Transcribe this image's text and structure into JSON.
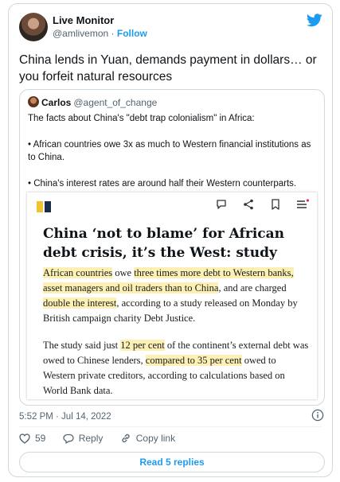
{
  "tweet": {
    "author_name": "Live Monitor",
    "author_handle": "@amlivemon",
    "separator": " · ",
    "follow_label": "Follow",
    "text": "China lends in Yuan, demands payment in dollars… or you forfeit natural resources",
    "timestamp": "5:52 PM · Jul 14, 2022",
    "likes": "59",
    "reply_label": "Reply",
    "copy_link_label": "Copy link",
    "read_replies_label": "Read 5 replies"
  },
  "quote": {
    "author_name": "Carlos",
    "author_handle": "@agent_of_change",
    "paragraphs": [
      "The facts about China's \"debt trap colonialism\" in Africa:",
      "• African countries owe 3x as much to Western financial institutions as to China.",
      "• China's interest rates are around half their Western counterparts."
    ]
  },
  "article": {
    "headline": "China ‘not to blame’ for African debt crisis, it’s the West: study",
    "p1": {
      "s1": "African countries",
      "s2": " owe ",
      "s3": "three times more debt to Western banks, asset managers and oil traders than to China",
      "s4": ", and are charged ",
      "s5": "double the interest",
      "s6": ", according to a study released on Monday by British campaign charity Debt Justice."
    },
    "p2": {
      "s1": "The study said just ",
      "s2": "12 per cent",
      "s3": " of the continent’s external debt was owed to Chinese lenders, ",
      "s4": "compared to 35 per cent",
      "s5": " owed to Western private creditors, according to calculations based on World Bank data."
    }
  },
  "icons": {
    "brand": "twitter-bird-icon",
    "info": "info-icon",
    "like": "heart-icon",
    "reply": "speech-bubble-icon",
    "copy": "link-icon",
    "comment": "comment-icon",
    "share": "share-icon",
    "bookmark": "bookmark-icon",
    "menu": "menu-icon"
  },
  "colors": {
    "accent": "#1d9bf0",
    "highlight": "#fdf0b4",
    "logo_yellow": "#f2c230",
    "logo_navy": "#1a2b4c"
  }
}
